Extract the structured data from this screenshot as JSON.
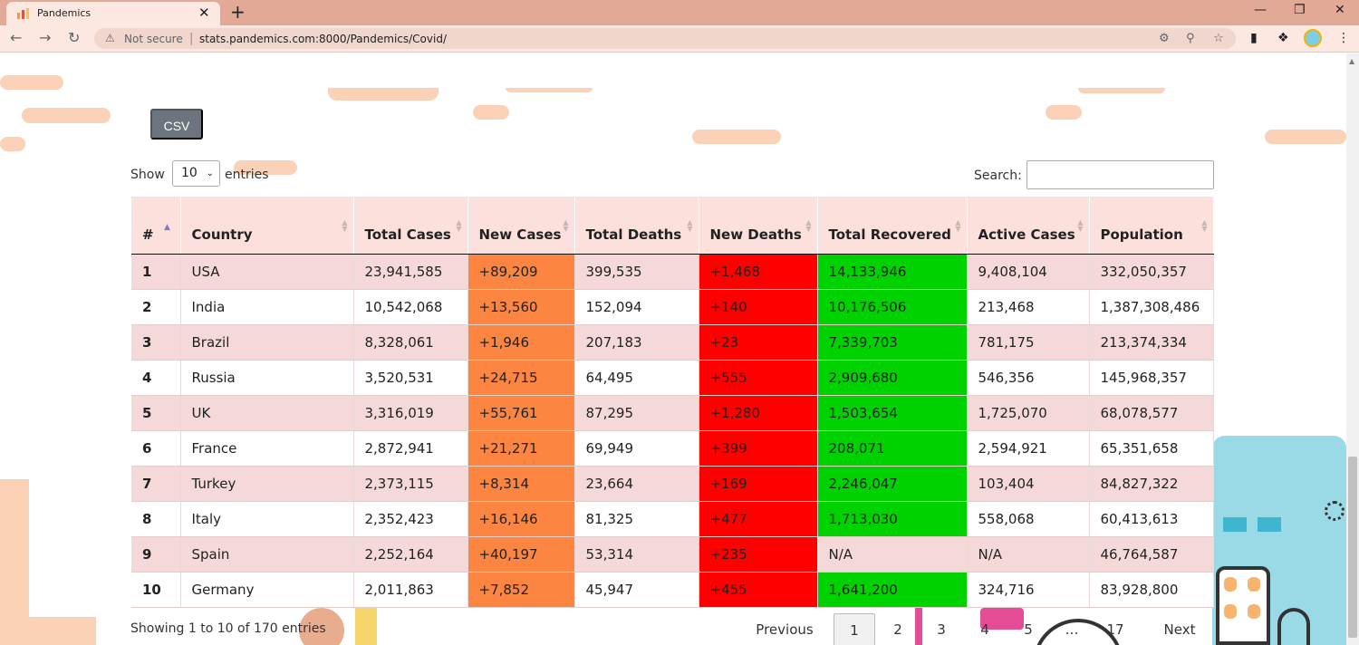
{
  "browser": {
    "tab_title": "Pandemics",
    "tab_close": "✕",
    "new_tab": "+",
    "not_secure": "Not secure",
    "url": "stats.pandemics.com:8000/Pandemics/Covid/",
    "profile_color": "#7fcde6"
  },
  "controls": {
    "csv_label": "CSV",
    "show_label": "Show",
    "entries_value": "10",
    "entries_label": "entries",
    "search_label": "Search:",
    "search_value": ""
  },
  "table": {
    "columns": [
      "#",
      "Country",
      "Total Cases",
      "New Cases",
      "Total Deaths",
      "New Deaths",
      "Total Recovered",
      "Active Cases",
      "Population"
    ],
    "rows": [
      [
        "1",
        "USA",
        "23,941,585",
        "+89,209",
        "399,535",
        "+1,468",
        "14,133,946",
        "9,408,104",
        "332,050,357"
      ],
      [
        "2",
        "India",
        "10,542,068",
        "+13,560",
        "152,094",
        "+140",
        "10,176,506",
        "213,468",
        "1,387,308,486"
      ],
      [
        "3",
        "Brazil",
        "8,328,061",
        "+1,946",
        "207,183",
        "+23",
        "7,339,703",
        "781,175",
        "213,374,334"
      ],
      [
        "4",
        "Russia",
        "3,520,531",
        "+24,715",
        "64,495",
        "+555",
        "2,909,680",
        "546,356",
        "145,968,357"
      ],
      [
        "5",
        "UK",
        "3,316,019",
        "+55,761",
        "87,295",
        "+1,280",
        "1,503,654",
        "1,725,070",
        "68,078,577"
      ],
      [
        "6",
        "France",
        "2,872,941",
        "+21,271",
        "69,949",
        "+399",
        "208,071",
        "2,594,921",
        "65,351,658"
      ],
      [
        "7",
        "Turkey",
        "2,373,115",
        "+8,314",
        "23,664",
        "+169",
        "2,246,047",
        "103,404",
        "84,827,322"
      ],
      [
        "8",
        "Italy",
        "2,352,423",
        "+16,146",
        "81,325",
        "+477",
        "1,713,030",
        "558,068",
        "60,413,613"
      ],
      [
        "9",
        "Spain",
        "2,252,164",
        "+40,197",
        "53,314",
        "+235",
        "N/A",
        "N/A",
        "46,764,587"
      ],
      [
        "10",
        "Germany",
        "2,011,863",
        "+7,852",
        "45,947",
        "+455",
        "1,641,200",
        "324,716",
        "83,928,800"
      ]
    ],
    "colors": {
      "new_cases": "#fb8541",
      "new_deaths": "#ff0000",
      "recovered": "#00d200",
      "odd_row": "#f5d9d8",
      "header": "#fbe0dc"
    }
  },
  "footer": {
    "info": "Showing 1 to 10 of 170 entries",
    "previous": "Previous",
    "pages": [
      "1",
      "2",
      "3",
      "4",
      "5",
      "…",
      "17"
    ],
    "active_page": "1",
    "next": "Next"
  }
}
